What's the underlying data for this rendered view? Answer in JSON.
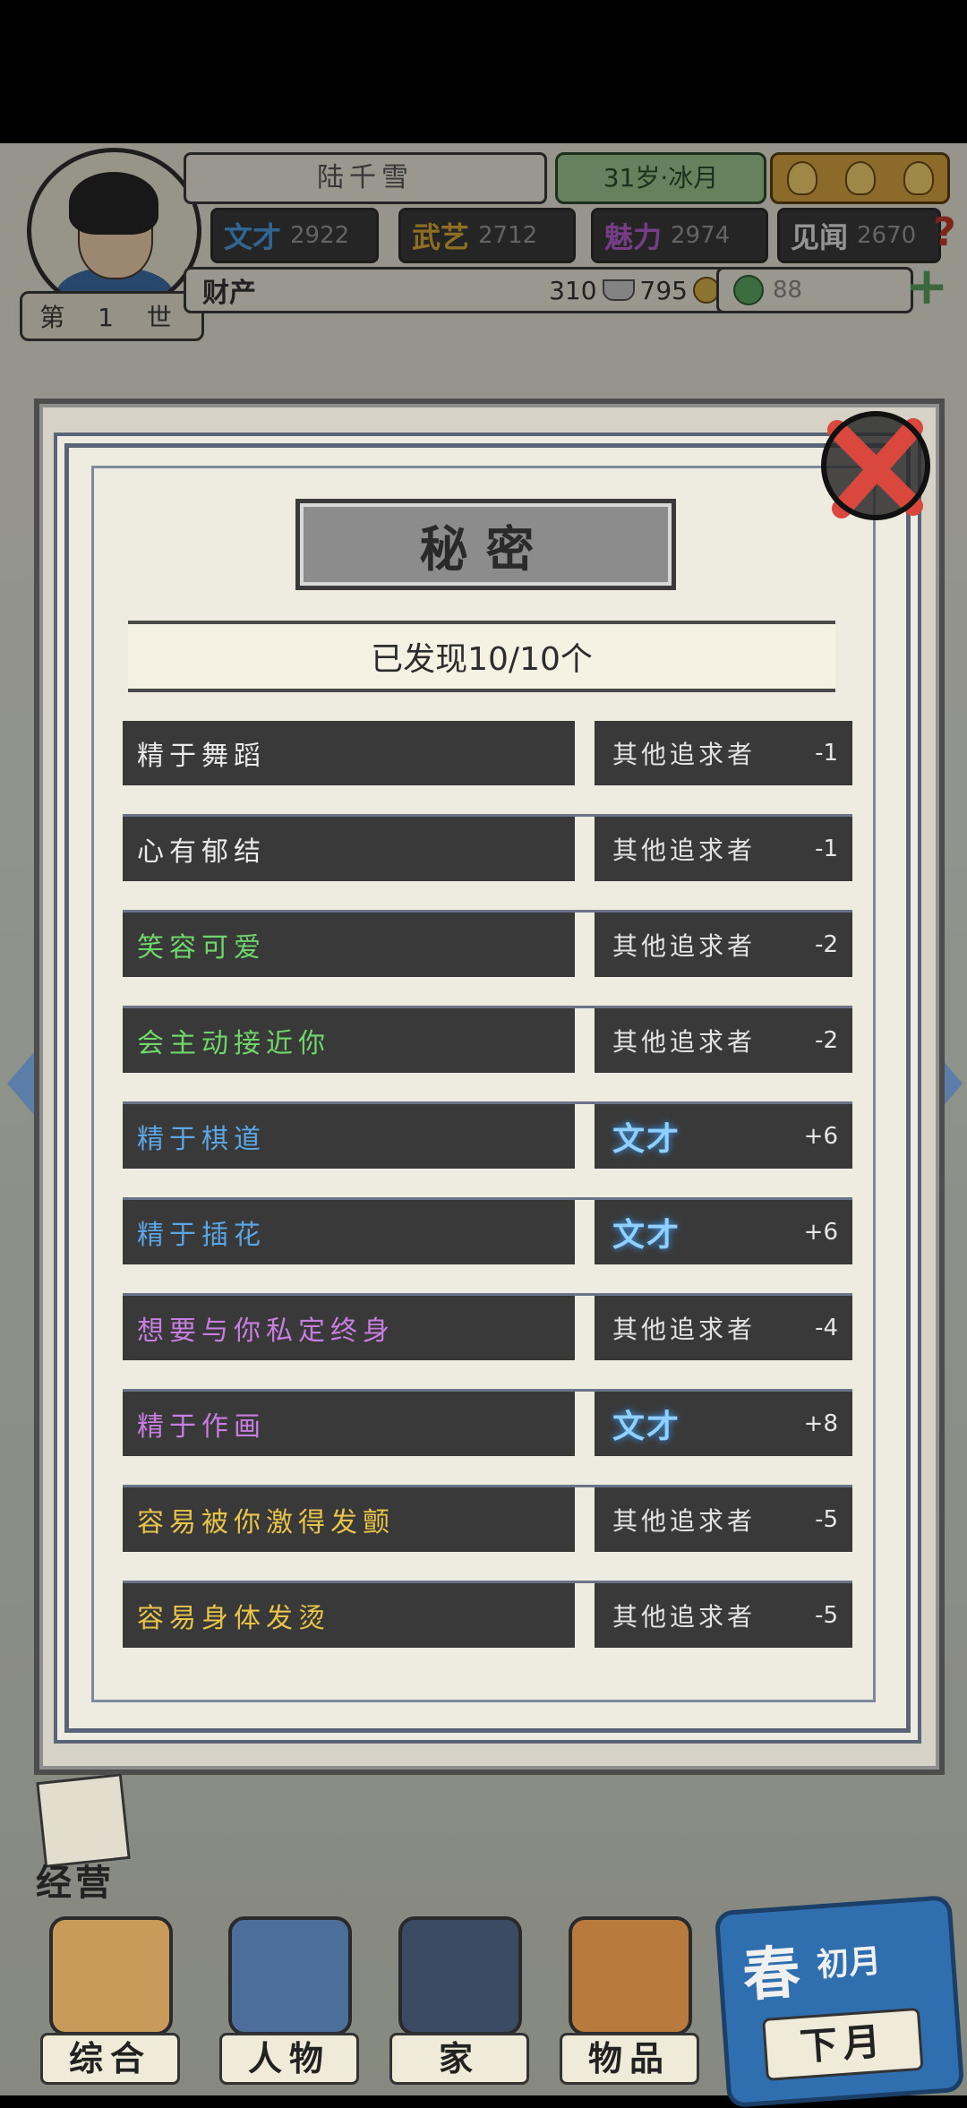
{
  "header": {
    "name": "陆千雪",
    "age_label": "31岁·冰月",
    "generation": "第 1 世",
    "attributes": [
      {
        "label": "文才",
        "value": "2922",
        "color": "#4a9de0"
      },
      {
        "label": "武艺",
        "value": "2712",
        "color": "#d8a93a"
      },
      {
        "label": "魅力",
        "value": "2974",
        "color": "#b65fd0"
      },
      {
        "label": "见闻",
        "value": "2670",
        "color": "#e3e3e3"
      }
    ],
    "wealth_label": "财产",
    "silver": "310",
    "copper": "795",
    "fame": "88"
  },
  "modal": {
    "title": "秘密",
    "discovered": "已发现10/10个",
    "rows": [
      {
        "trait": "精于舞蹈",
        "trait_color": "#eaeaea",
        "effect": "其他追求者",
        "effect_style": "normal",
        "value": "-1"
      },
      {
        "trait": "心有郁结",
        "trait_color": "#eaeaea",
        "effect": "其他追求者",
        "effect_style": "normal",
        "value": "-1"
      },
      {
        "trait": "笑容可爱",
        "trait_color": "#6fd66a",
        "effect": "其他追求者",
        "effect_style": "normal",
        "value": "-2"
      },
      {
        "trait": "会主动接近你",
        "trait_color": "#6fd66a",
        "effect": "其他追求者",
        "effect_style": "normal",
        "value": "-2"
      },
      {
        "trait": "精于棋道",
        "trait_color": "#5aa6e6",
        "effect": "文才",
        "effect_style": "wen",
        "value": "+6"
      },
      {
        "trait": "精于插花",
        "trait_color": "#5aa6e6",
        "effect": "文才",
        "effect_style": "wen",
        "value": "+6"
      },
      {
        "trait": "想要与你私定终身",
        "trait_color": "#c77ee0",
        "effect": "其他追求者",
        "effect_style": "normal",
        "value": "-4"
      },
      {
        "trait": "精于作画",
        "trait_color": "#c77ee0",
        "effect": "文才",
        "effect_style": "wen",
        "value": "+8"
      },
      {
        "trait": "容易被你激得发颤",
        "trait_color": "#e8c44a",
        "effect": "其他追求者",
        "effect_style": "normal",
        "value": "-5"
      },
      {
        "trait": "容易身体发烫",
        "trait_color": "#e8c44a",
        "effect": "其他追求者",
        "effect_style": "normal",
        "value": "-5"
      }
    ]
  },
  "bottom_nav": {
    "manage": "经营",
    "items": [
      "综合",
      "人物",
      "家",
      "物品"
    ],
    "season": "春",
    "month": "初月",
    "next": "下月"
  }
}
